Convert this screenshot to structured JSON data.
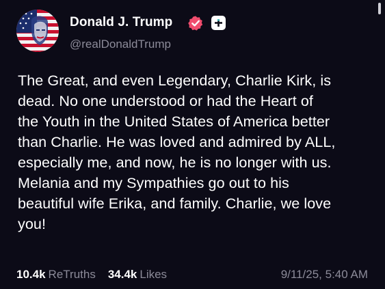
{
  "post": {
    "author": {
      "display_name": "Donald J. Trump",
      "handle": "@realDonaldTrump",
      "verified_badge_icon": "verified-badge-icon",
      "verified_badge_color": "#f04d6e",
      "follow_icon": "plus-icon"
    },
    "body_lines": [
      "The Great, and even Legendary, Charlie Kirk, is",
      "dead. No one understood or had the Heart of",
      "the Youth in the United States of America better",
      "than Charlie. He was loved and admired by ALL,",
      "especially me, and now, he is no longer with us.",
      "Melania and my Sympathies go out to his",
      "beautiful wife Erika, and family. Charlie, we love",
      "you!"
    ],
    "stats": {
      "retruths_count": "10.4k",
      "retruths_label": "ReTruths",
      "likes_count": "34.4k",
      "likes_label": "Likes"
    },
    "timestamp": "9/11/25, 5:40 AM"
  },
  "colors": {
    "background": "#0c0b17",
    "text_primary": "#ffffff",
    "text_secondary": "#8c8b99"
  }
}
